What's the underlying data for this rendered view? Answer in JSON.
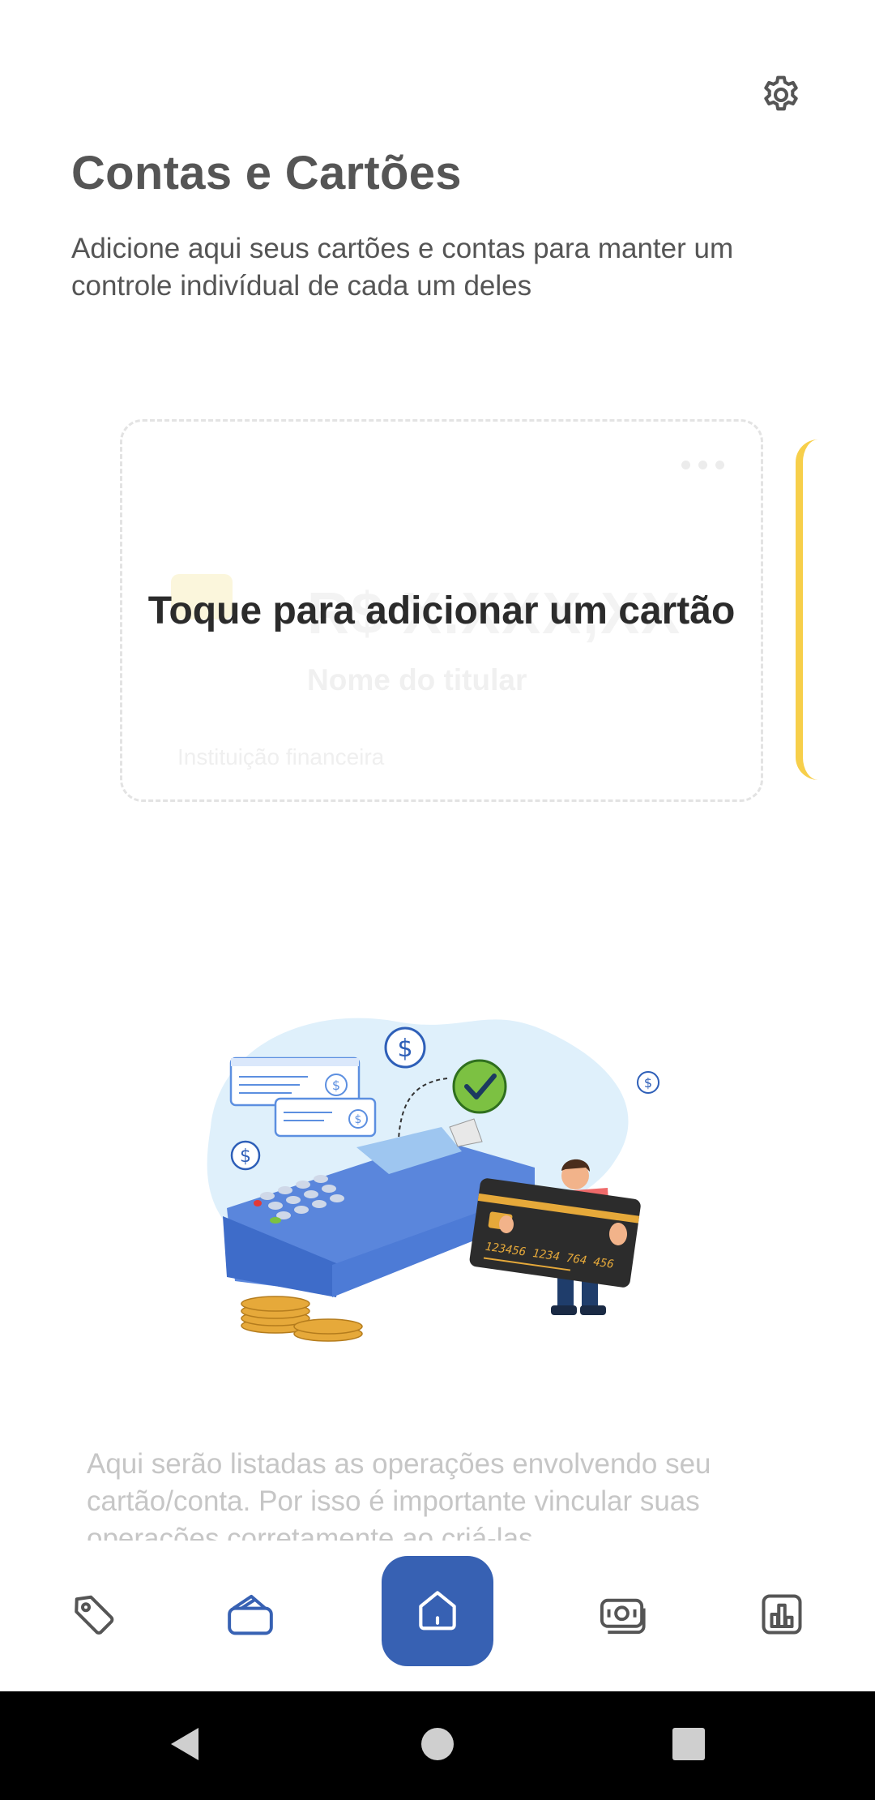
{
  "header": {
    "title": "Contas e Cartões",
    "subtitle": "Adicione aqui seus cartões e contas para manter um controle indivídual de cada um deles",
    "settings_icon": "gear-icon"
  },
  "card_placeholder": {
    "cta": "Toque para adicionar um cartão",
    "balance": "R$ X.XXX,XX",
    "holder_name": "Nome do titular",
    "institution": "Instituição financeira",
    "menu_icon": "more-dots-icon"
  },
  "illustration": {
    "card_number": "123456  1234  764  456"
  },
  "empty_state": {
    "message": "Aqui serão listadas as operações envolvendo seu cartão/conta. Por isso é importante vincular suas operações corretamente ao criá-las."
  },
  "bottom_nav": {
    "items": [
      {
        "icon": "tag-icon",
        "active": false
      },
      {
        "icon": "wallet-icon",
        "active": true
      },
      {
        "icon": "home-icon",
        "active": false
      },
      {
        "icon": "cash-icon",
        "active": false
      },
      {
        "icon": "bar-chart-icon",
        "active": false
      }
    ]
  },
  "colors": {
    "primary": "#3761b3",
    "text": "#555555",
    "muted": "#c6c6c6",
    "accent_yellow": "#f7cf4a"
  }
}
